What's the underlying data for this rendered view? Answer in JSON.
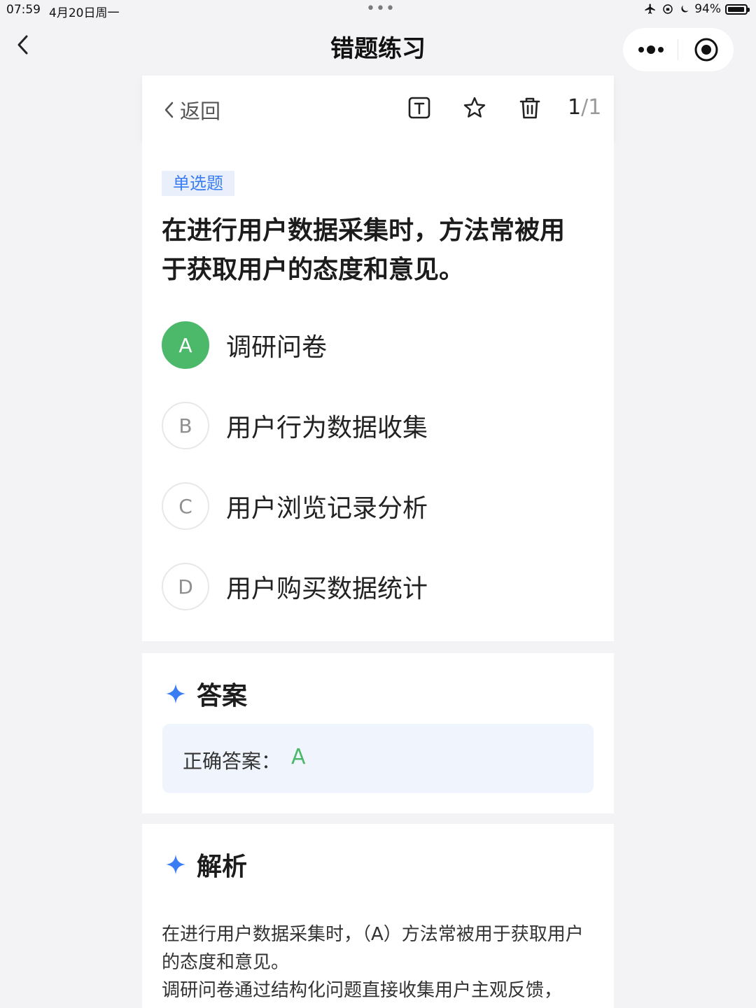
{
  "status_bar": {
    "time": "07:59",
    "date": "4月20日周一",
    "battery": "94%",
    "battery_level": 0.94
  },
  "nav": {
    "title": "错题练习"
  },
  "toolbar": {
    "back_label": "返回",
    "current": "1",
    "total": "/1",
    "icons": [
      "text-size-icon",
      "star-icon",
      "trash-icon"
    ]
  },
  "question": {
    "type": "单选题",
    "text": "在进行用户数据采集时，方法常被用于获取用户的态度和意见。",
    "options": [
      {
        "letter": "A",
        "text": "调研问卷",
        "correct": true
      },
      {
        "letter": "B",
        "text": "用户行为数据收集",
        "correct": false
      },
      {
        "letter": "C",
        "text": "用户浏览记录分析",
        "correct": false
      },
      {
        "letter": "D",
        "text": "用户购买数据统计",
        "correct": false
      }
    ]
  },
  "answer": {
    "title": "答案",
    "label": "正确答案：",
    "value": "A"
  },
  "explanation": {
    "title": "解析",
    "lines": [
      "在进行用户数据采集时，（A）方法常被用于获取用户的态度和意见。",
      "调研问卷通过结构化问题直接收集用户主观反馈，"
    ]
  },
  "colors": {
    "accent_blue": "#3a7cf2",
    "correct_green": "#4cb86a",
    "page_bg": "#f3f3f5"
  }
}
